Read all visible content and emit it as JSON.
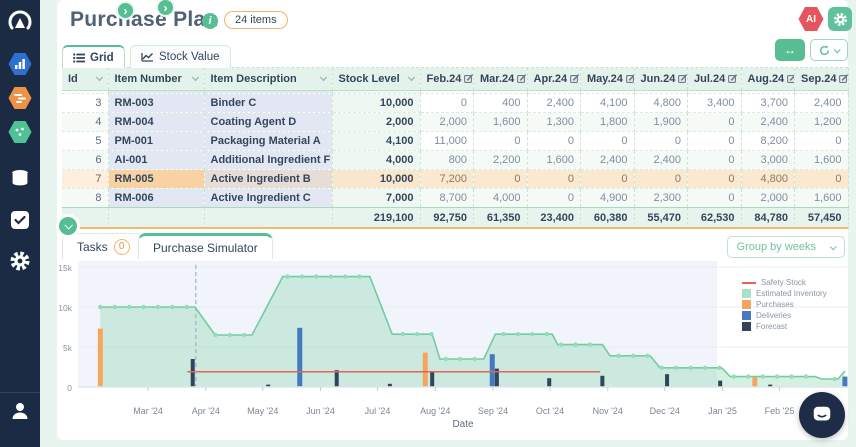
{
  "header": {
    "title": "Purchase Plan",
    "items_badge": "24 items",
    "ai_label": "AI"
  },
  "top_tabs": [
    {
      "label": "Grid",
      "active": true,
      "icon": "list-icon"
    },
    {
      "label": "Stock Value",
      "active": false,
      "icon": "line-chart-icon"
    }
  ],
  "bottom_tabs": [
    {
      "label": "Tasks",
      "badge": "0",
      "active": false
    },
    {
      "label": "Purchase Simulator",
      "active": true
    }
  ],
  "group_by": {
    "value": "Group by weeks"
  },
  "sidebar_icons": [
    "logo",
    "analytics-hexagon",
    "planner-hexagon",
    "simulator-hexagon",
    "database",
    "tasks-check",
    "settings-gear",
    "user"
  ],
  "colors": {
    "accent_green": "#57bd93",
    "accent_orange": "#f3b871",
    "navy": "#33475b",
    "sidebar": "#1b2b44",
    "highlight_row": "#f8d2a2",
    "safety": "#e2645a",
    "inventory": "#8dd8b2",
    "purchases": "#f5a65e",
    "deliveries": "#4679c0",
    "forecast": "#31445c"
  },
  "table": {
    "columns": [
      {
        "label": "Id",
        "kind": "sort"
      },
      {
        "label": "Item Number",
        "kind": "sort"
      },
      {
        "label": "Item Description",
        "kind": "sort"
      },
      {
        "label": "Stock Level",
        "kind": "sort"
      },
      {
        "label": "Feb.24",
        "kind": "edit"
      },
      {
        "label": "Mar.24",
        "kind": "edit"
      },
      {
        "label": "Apr.24",
        "kind": "edit"
      },
      {
        "label": "May.24",
        "kind": "edit"
      },
      {
        "label": "Jun.24",
        "kind": "edit"
      },
      {
        "label": "Jul.24",
        "kind": "edit"
      },
      {
        "label": "Aug.24",
        "kind": "edit"
      },
      {
        "label": "Sep.24",
        "kind": "edit2"
      }
    ],
    "rows": [
      {
        "id": "3",
        "item_number": "RM-003",
        "description": "Binder C",
        "stock_level": "10,000",
        "months": [
          "0",
          "400",
          "2,400",
          "4,100",
          "4,800",
          "3,400",
          "3,700",
          "2,400"
        ],
        "highlight": false
      },
      {
        "id": "4",
        "item_number": "RM-004",
        "description": "Coating Agent D",
        "stock_level": "2,000",
        "months": [
          "2,000",
          "1,600",
          "1,300",
          "1,800",
          "1,900",
          "0",
          "2,400",
          "1,200"
        ],
        "highlight": false
      },
      {
        "id": "5",
        "item_number": "PM-001",
        "description": "Packaging Material A",
        "stock_level": "4,100",
        "months": [
          "11,000",
          "0",
          "0",
          "0",
          "0",
          "0",
          "8,200",
          "0"
        ],
        "highlight": false
      },
      {
        "id": "6",
        "item_number": "AI-001",
        "description": "Additional Ingredient F",
        "stock_level": "4,000",
        "months": [
          "800",
          "2,200",
          "1,600",
          "2,400",
          "2,400",
          "0",
          "3,000",
          "1,600"
        ],
        "highlight": false
      },
      {
        "id": "7",
        "item_number": "RM-005",
        "description": "Active Ingredient B",
        "stock_level": "10,000",
        "months": [
          "7,200",
          "0",
          "0",
          "0",
          "0",
          "0",
          "4,800",
          "0"
        ],
        "highlight": true
      },
      {
        "id": "8",
        "item_number": "RM-006",
        "description": "Active Ingredient C",
        "stock_level": "7,000",
        "months": [
          "8,700",
          "4,000",
          "0",
          "4,900",
          "2,300",
          "0",
          "2,000",
          "1,600"
        ],
        "highlight": false
      }
    ],
    "totals": {
      "stock_level": "219,100",
      "months": [
        "92,750",
        "61,350",
        "23,400",
        "60,380",
        "55,470",
        "62,530",
        "84,780",
        "57,450"
      ]
    }
  },
  "chart_data": {
    "type": "line",
    "title": "Purchase Simulator",
    "xlabel": "Date",
    "ylim": [
      0,
      15750
    ],
    "yticks": [
      {
        "label": "0",
        "value": 0
      },
      {
        "label": "5k",
        "value": 5000
      },
      {
        "label": "10k",
        "value": 10000
      },
      {
        "label": "15k",
        "value": 15000
      }
    ],
    "xticks": [
      {
        "label": "Mar '24",
        "f": 0.091
      },
      {
        "label": "Apr '24",
        "f": 0.166
      },
      {
        "label": "May '24",
        "f": 0.24
      },
      {
        "label": "Jun '24",
        "f": 0.315
      },
      {
        "label": "Jul '24",
        "f": 0.389
      },
      {
        "label": "Aug '24",
        "f": 0.464
      },
      {
        "label": "Sep '24",
        "f": 0.539
      },
      {
        "label": "Oct '24",
        "f": 0.613
      },
      {
        "label": "Nov '24",
        "f": 0.688
      },
      {
        "label": "Dec '24",
        "f": 0.762
      },
      {
        "label": "Jan '25",
        "f": 0.837
      },
      {
        "label": "Feb '25",
        "f": 0.911
      }
    ],
    "today_line_f": 0.153,
    "shaded_region": [
      0,
      0.83
    ],
    "legend": [
      {
        "name": "Safety Stock",
        "color": "#e2645a",
        "swatch": "line"
      },
      {
        "name": "Estimated Inventory",
        "color": "#a9e3c7",
        "swatch": "box"
      },
      {
        "name": "Purchases",
        "color": "#f5a65e",
        "swatch": "box"
      },
      {
        "name": "Deliveries",
        "color": "#4679c0",
        "swatch": "box"
      },
      {
        "name": "Forecast",
        "color": "#31445c",
        "swatch": "box"
      }
    ],
    "series": [
      {
        "name": "Estimated Inventory",
        "type": "area",
        "color": "#74cba2",
        "fill": "rgba(141,216,178,0.38)",
        "points": [
          [
            0.029,
            10000
          ],
          [
            0.152,
            10000
          ],
          [
            0.178,
            6500
          ],
          [
            0.226,
            6500
          ],
          [
            0.266,
            13800
          ],
          [
            0.379,
            13800
          ],
          [
            0.408,
            6600
          ],
          [
            0.46,
            6600
          ],
          [
            0.47,
            3500
          ],
          [
            0.527,
            3500
          ],
          [
            0.542,
            6600
          ],
          [
            0.616,
            6600
          ],
          [
            0.623,
            5300
          ],
          [
            0.681,
            5300
          ],
          [
            0.691,
            3900
          ],
          [
            0.743,
            3900
          ],
          [
            0.756,
            2400
          ],
          [
            0.836,
            2400
          ],
          [
            0.847,
            1300
          ],
          [
            0.957,
            1300
          ],
          [
            0.966,
            1000
          ],
          [
            0.987,
            1000
          ],
          [
            0.996,
            2000
          ]
        ]
      },
      {
        "name": "Safety Stock",
        "type": "line",
        "color": "#e2645a",
        "points": [
          [
            0.142,
            1900
          ],
          [
            0.678,
            1900
          ]
        ]
      },
      {
        "name": "Purchases",
        "type": "bar",
        "color": "#f5a65e",
        "barw": 5,
        "points": [
          [
            0.029,
            7300
          ],
          [
            0.451,
            4300
          ],
          [
            0.879,
            1200
          ]
        ]
      },
      {
        "name": "Deliveries",
        "type": "bar",
        "color": "#4679c0",
        "barw": 5,
        "points": [
          [
            0.288,
            7400
          ],
          [
            0.538,
            4100
          ],
          [
            0.996,
            1300
          ]
        ]
      },
      {
        "name": "Forecast",
        "type": "bar",
        "color": "#31445c",
        "barw": 4,
        "points": [
          [
            0.149,
            3500
          ],
          [
            0.247,
            300
          ],
          [
            0.336,
            2100
          ],
          [
            0.405,
            400
          ],
          [
            0.46,
            2000
          ],
          [
            0.544,
            2300
          ],
          [
            0.612,
            1100
          ],
          [
            0.681,
            1400
          ],
          [
            0.765,
            1600
          ],
          [
            0.834,
            800
          ],
          [
            0.899,
            300
          ]
        ]
      }
    ]
  }
}
